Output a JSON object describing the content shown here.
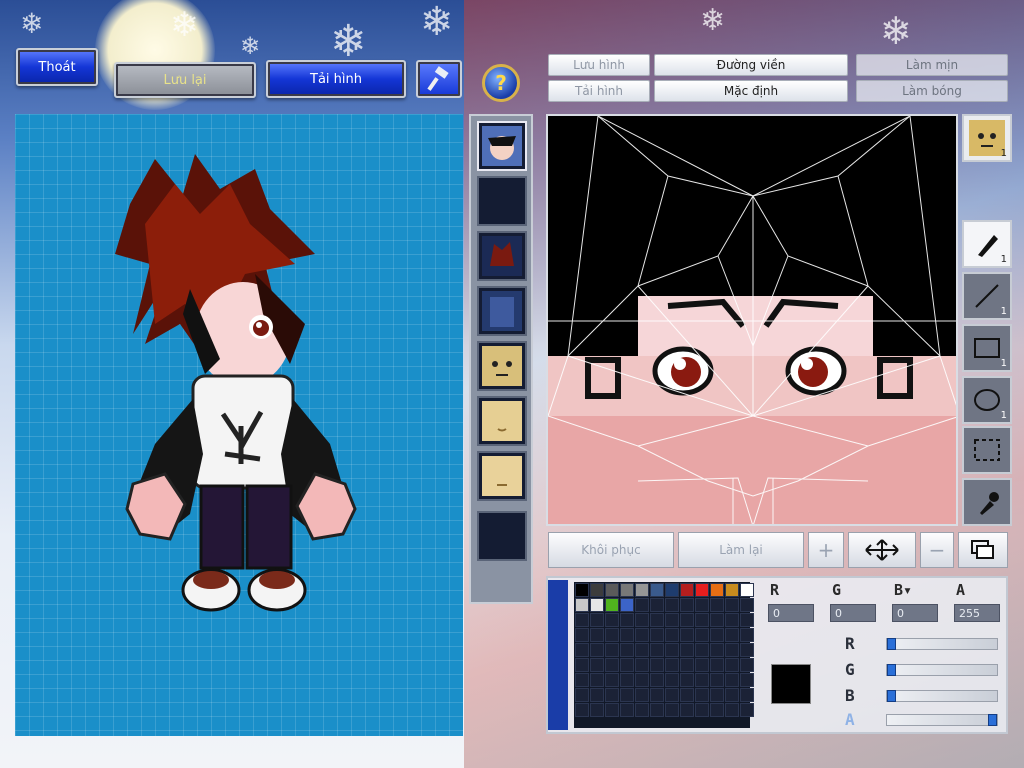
{
  "top_buttons": {
    "exit_label": "Thoát",
    "save_label": "Lưu lại",
    "reload_label": "Tải hình"
  },
  "editor_tabs": {
    "save_image": "Lưu hình",
    "outline": "Đường viền",
    "smooth": "Làm mịn",
    "load_image": "Tải hình",
    "default": "Mặc định",
    "shine": "Làm bóng"
  },
  "editor_buttons": {
    "restore": "Khôi phục",
    "redo": "Làm lại"
  },
  "face_icon_count": "1",
  "tools": [
    {
      "name": "pen-tool",
      "count": "1",
      "active": true
    },
    {
      "name": "line-tool",
      "count": "1",
      "active": false
    },
    {
      "name": "rect-tool",
      "count": "1",
      "active": false
    },
    {
      "name": "ellipse-tool",
      "count": "1",
      "active": false
    },
    {
      "name": "select-tool",
      "count": "",
      "active": false
    },
    {
      "name": "eyedropper-tool",
      "count": "",
      "active": false
    }
  ],
  "channels": {
    "r_label": "R",
    "g_label": "G",
    "b_label": "B",
    "a_label": "A",
    "r_value": "0",
    "g_value": "0",
    "b_value": "0",
    "a_value": "255"
  },
  "sliders": {
    "r": 0,
    "g": 0,
    "b": 0,
    "a": 1
  },
  "palette_colors": [
    "#000000",
    "#3c3c3c",
    "#5a5a5a",
    "#787878",
    "#969696",
    "#3a5a8c",
    "#1e3c6e",
    "#b41e1e",
    "#e61e1e",
    "#e66e14",
    "#c88c1e",
    "#ffffff",
    "#c8c8c8",
    "#e6e6e6",
    "#50b41e",
    "#3c64c8"
  ],
  "current_color": "#000000"
}
